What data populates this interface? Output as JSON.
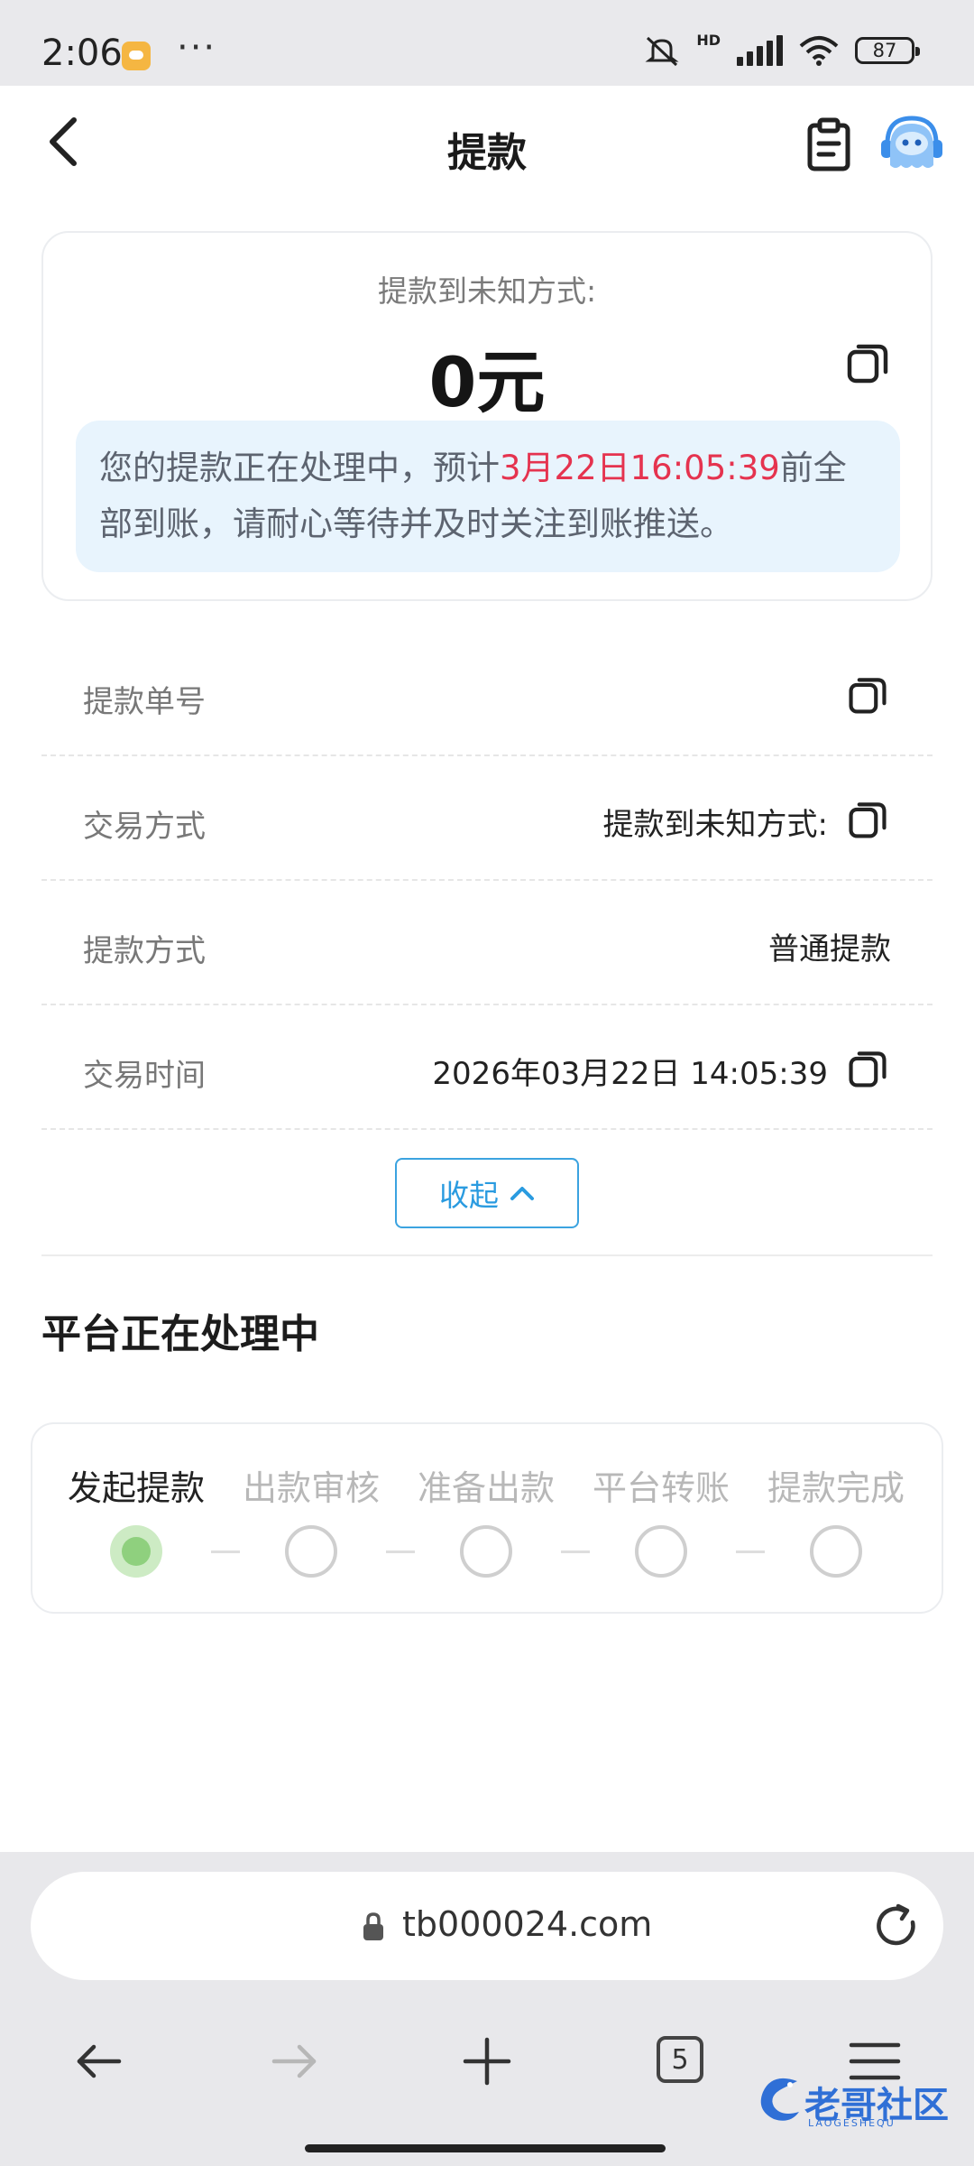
{
  "status_bar": {
    "time": "2:06",
    "more": "···",
    "hd": "HD",
    "battery": "87"
  },
  "header": {
    "title": "提款"
  },
  "summary": {
    "method_label": "提款到未知方式:",
    "amount": "0元",
    "notice_prefix": "您的提款正在处理中，预计",
    "notice_highlight": "3月22日16:05:39",
    "notice_suffix": "前全部到账，请耐心等待并及时关注到账推送。"
  },
  "details": [
    {
      "label": "提款单号",
      "value": "",
      "copy": true
    },
    {
      "label": "交易方式",
      "value": "提款到未知方式:",
      "copy": true
    },
    {
      "label": "提款方式",
      "value": "普通提款",
      "copy": false
    },
    {
      "label": "交易时间",
      "value": "2026年03月22日 14:05:39",
      "copy": true
    }
  ],
  "collapse_label": "收起",
  "section_title": "平台正在处理中",
  "steps": [
    {
      "label": "发起提款",
      "active": true
    },
    {
      "label": "出款审核",
      "active": false
    },
    {
      "label": "准备出款",
      "active": false
    },
    {
      "label": "平台转账",
      "active": false
    },
    {
      "label": "提款完成",
      "active": false
    }
  ],
  "browser": {
    "url": "tb000024.com",
    "tab_count": "5"
  },
  "watermark": {
    "text": "老哥社区",
    "sub": "LAOGESHEQU"
  },
  "colors": {
    "accent": "#2a9be0",
    "highlight": "#e5334f",
    "notice_bg": "#e8f4fd",
    "step_active": "#8fd07e"
  }
}
